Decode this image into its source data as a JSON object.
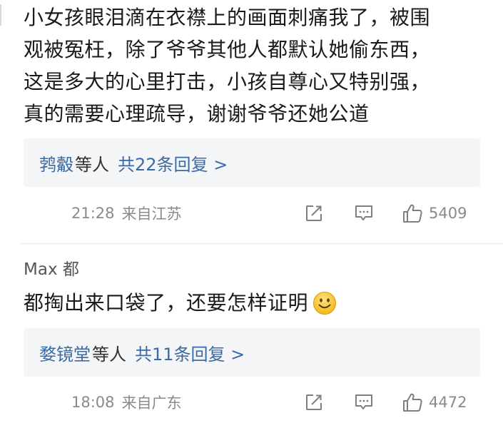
{
  "comment1": {
    "text": "小女孩眼泪滴在衣襟上的画面刺痛我了，被围观被冤枉，除了爷爷其他人都默认她偷东西，这是多大的心里打击，小孩自尊心又特别强，真的需要心理疏导，谢谢爷爷还她公道",
    "lines": [
      "小女孩眼泪滴在衣襟上的画面刺痛我了，被围",
      "观被冤枉，除了爷爷其他人都默认她偷东西，",
      "这是多大的心里打击，小孩自尊心又特别强，",
      "真的需要心理疏导，谢谢爷爷还她公道"
    ],
    "replies": {
      "names": "鹁觳",
      "suffix": "等人",
      "count_text": "共22条回复 >"
    },
    "meta": {
      "time": "21:28",
      "location": "来自江苏",
      "likes": "5409"
    }
  },
  "comment2": {
    "user": "Max 都",
    "text": "都掏出来口袋了，还要怎样证明",
    "emoji": "smile-emoji",
    "replies": {
      "names": "婺镜堂",
      "suffix": "等人",
      "count_text": "共11条回复 >"
    },
    "meta": {
      "time": "18:08",
      "location": "来自广东",
      "likes": "4472"
    }
  },
  "colors": {
    "link_blue": "#3a6aa6",
    "text_main": "#1a1a1a",
    "meta_gray": "#8a8a8a",
    "reply_bg": "#f4f5f7",
    "icon_gray": "#7f7f7f",
    "emoji_yellow": "#f7c531"
  },
  "icons": {
    "share": "share-icon",
    "comment": "comment-icon",
    "like": "thumbs-up-icon"
  }
}
